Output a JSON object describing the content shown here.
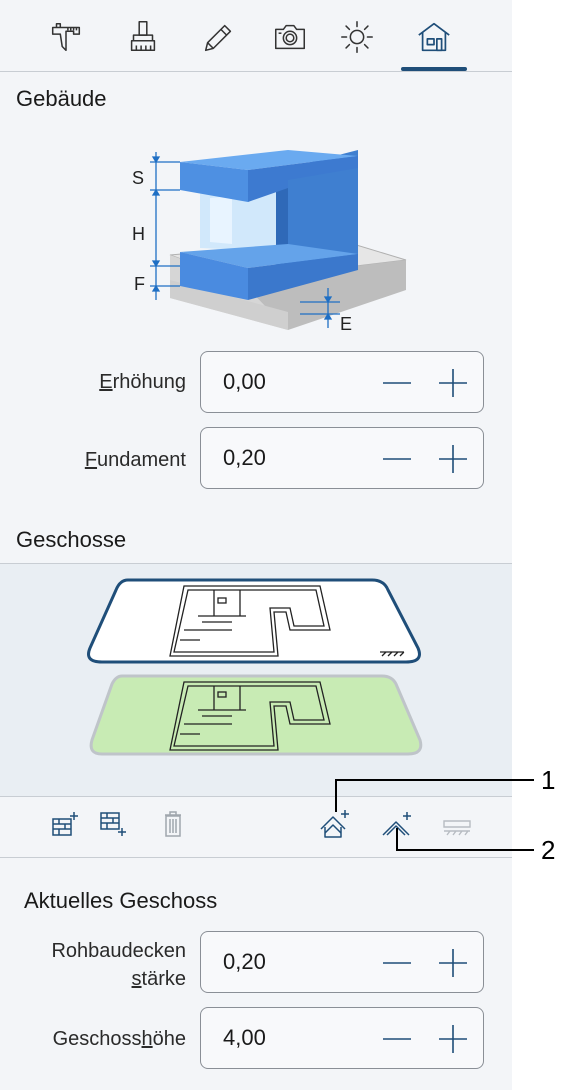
{
  "tabs": [
    {
      "name": "dimensions",
      "icon": "caliper-icon"
    },
    {
      "name": "materials",
      "icon": "brush-icon"
    },
    {
      "name": "edit",
      "icon": "pencil-icon"
    },
    {
      "name": "camera",
      "icon": "camera-icon"
    },
    {
      "name": "lighting",
      "icon": "sun-icon"
    },
    {
      "name": "building",
      "icon": "house-icon",
      "active": true
    }
  ],
  "building": {
    "title": "Gebäude",
    "diagram_labels": {
      "s": "S",
      "h": "H",
      "f": "F",
      "e": "E"
    },
    "elevation": {
      "label_accel": "E",
      "label_rest": "rhöhung",
      "value": "0,00"
    },
    "foundation": {
      "label_accel": "F",
      "label_rest": "undament",
      "value": "0,20"
    }
  },
  "floors": {
    "title": "Geschosse",
    "callouts": {
      "one": "1",
      "two": "2"
    }
  },
  "current_floor": {
    "title": "Aktuelles Geschoss",
    "slab": {
      "label_line1": "Rohbaudecken",
      "label_accel": "s",
      "label_rest": "tärke",
      "value": "0,20"
    },
    "height": {
      "label_pre": "Geschoss",
      "label_accel": "h",
      "label_rest": "öhe",
      "value": "4,00"
    }
  },
  "colors": {
    "accent": "#1f4e79",
    "panel_bg": "#f3f5f8",
    "floor_green": "#c8ebb4",
    "building_blue": "#4f93dd"
  }
}
